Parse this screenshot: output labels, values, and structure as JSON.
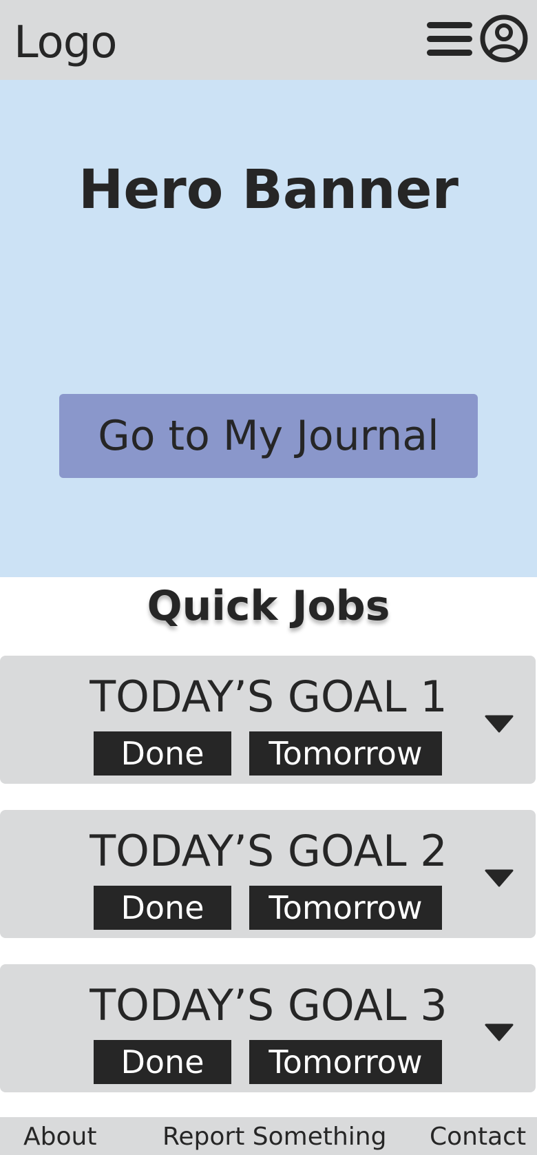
{
  "header": {
    "logo": "Logo",
    "menu_icon": "hamburger-menu-icon",
    "account_icon": "user-circle-icon"
  },
  "hero": {
    "title": "Hero Banner",
    "cta_label": "Go to My Journal"
  },
  "quick_jobs": {
    "title": "Quick Jobs",
    "goals": [
      {
        "title": "TODAY’S GOAL 1",
        "done_label": "Done",
        "tomorrow_label": "Tomorrow"
      },
      {
        "title": "TODAY’S GOAL 2",
        "done_label": "Done",
        "tomorrow_label": "Tomorrow"
      },
      {
        "title": "TODAY’S GOAL 3",
        "done_label": "Done",
        "tomorrow_label": "Tomorrow"
      }
    ]
  },
  "footer": {
    "about": "About",
    "report": "Report Something",
    "contact": "Contact"
  },
  "colors": {
    "header_bg": "#d9dadb",
    "hero_bg": "#cce2f5",
    "cta_bg": "#8a97cb",
    "text": "#262626",
    "button_bg": "#262626"
  }
}
